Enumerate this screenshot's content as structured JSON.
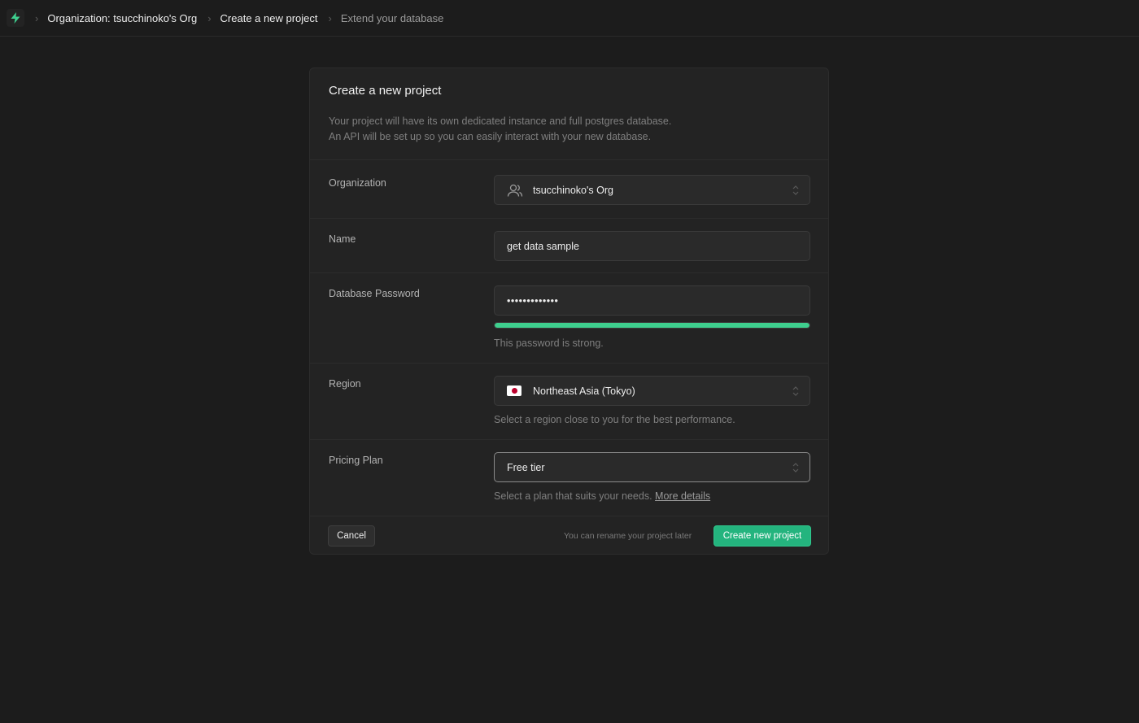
{
  "breadcrumbs": [
    {
      "label": "Organization: tsucchinoko's Org"
    },
    {
      "label": "Create a new project"
    },
    {
      "label": "Extend your database"
    }
  ],
  "card": {
    "title": "Create a new project",
    "description_line1": "Your project will have its own dedicated instance and full postgres database.",
    "description_line2": "An API will be set up so you can easily interact with your new database."
  },
  "form": {
    "organization": {
      "label": "Organization",
      "value": "tsucchinoko's Org",
      "icon": "users-icon"
    },
    "name": {
      "label": "Name",
      "value": "get data sample"
    },
    "password": {
      "label": "Database Password",
      "value": "•••••••••••••",
      "strength_fraction": 1.0,
      "strength_text": "This password is strong."
    },
    "region": {
      "label": "Region",
      "value": "Northeast Asia (Tokyo)",
      "icon": "japan-flag-icon",
      "hint": "Select a region close to you for the best performance."
    },
    "pricing": {
      "label": "Pricing Plan",
      "value": "Free tier",
      "hint": "Select a plan that suits your needs.",
      "link": "More details"
    }
  },
  "footer": {
    "cancel_label": "Cancel",
    "note": "You can rename your project later",
    "create_label": "Create new project"
  },
  "colors": {
    "accent": "#3ecf8e",
    "button": "#24b47e",
    "background": "#1c1c1c",
    "card": "#232323"
  }
}
